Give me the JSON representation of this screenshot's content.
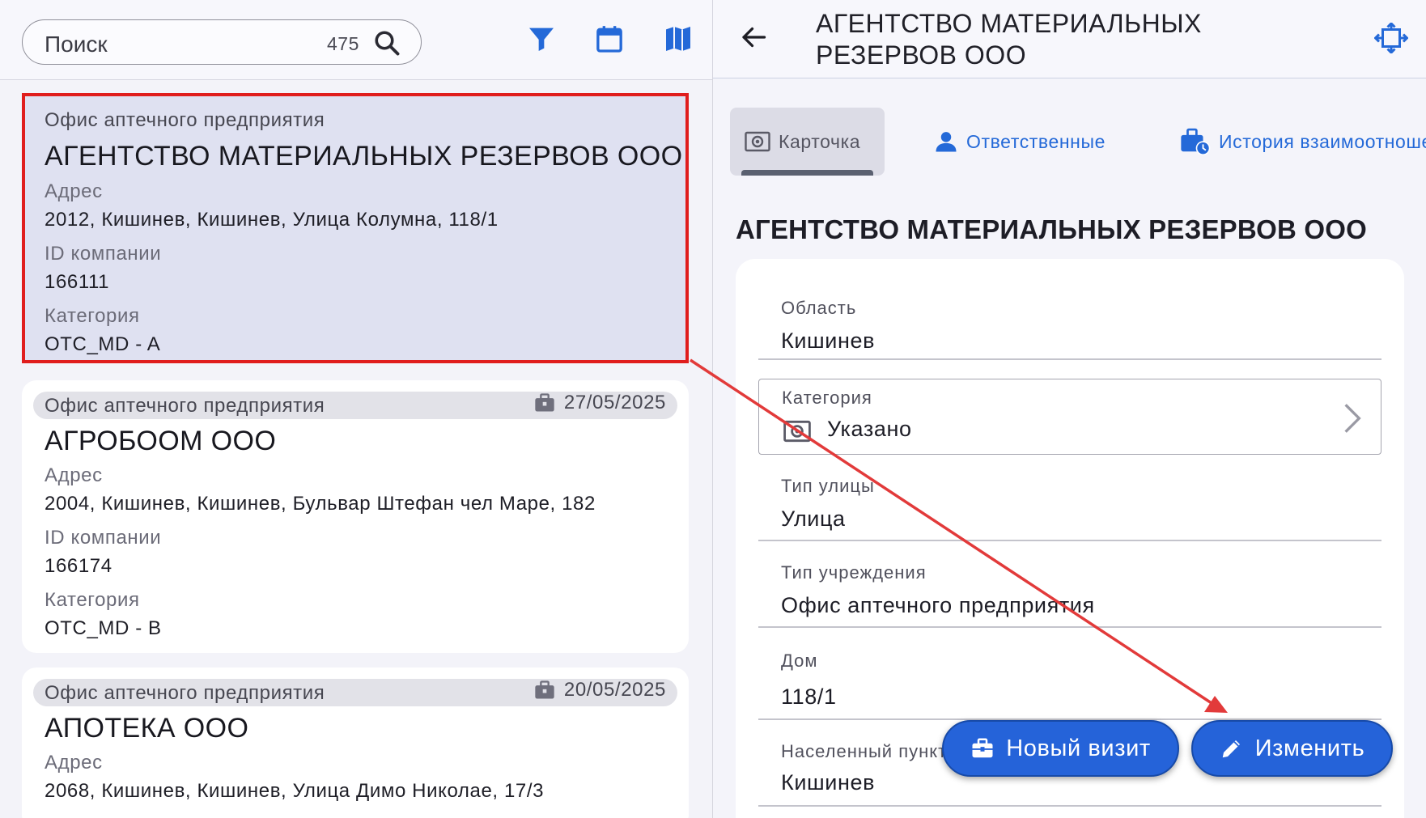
{
  "search": {
    "placeholder": "Поиск",
    "count": "475"
  },
  "header_icons": [
    "filter-icon",
    "calendar-icon",
    "map-icon"
  ],
  "list": [
    {
      "type": "Офис аптечного предприятия",
      "date": "",
      "name": "АГЕНТСТВО МАТЕРИАЛЬНЫХ РЕЗЕРВОВ ООО",
      "address_label": "Адрес",
      "address": "2012, Кишинев, Кишинев, Улица Колумна, 118/1",
      "id_label": "ID компании",
      "id": "166111",
      "category_label": "Категория",
      "category": "OTC_MD - A"
    },
    {
      "type": "Офис аптечного предприятия",
      "date": "27/05/2025",
      "name": "АГРОБООМ ООО",
      "address_label": "Адрес",
      "address": "2004, Кишинев, Кишинев, Бульвар Штефан чел Маре, 182",
      "id_label": "ID компании",
      "id": "166174",
      "category_label": "Категория",
      "category": "OTC_MD - B"
    },
    {
      "type": "Офис аптечного предприятия",
      "date": "20/05/2025",
      "name": "АПОТЕКА ООО",
      "address_label": "Адрес",
      "address": "2068, Кишинев, Кишинев, Улица Димо Николае, 17/3"
    }
  ],
  "detail": {
    "header_title": "АГЕНТСТВО МАТЕРИАЛЬНЫХ РЕЗЕРВОВ ООО",
    "tabs": [
      {
        "label": "Карточка",
        "icon": "card-icon",
        "active": true
      },
      {
        "label": "Ответственные",
        "icon": "person-icon",
        "active": false
      },
      {
        "label": "История взаимоотношений",
        "icon": "history-icon",
        "active": false
      }
    ],
    "section_title": "АГЕНТСТВО МАТЕРИАЛЬНЫХ РЕЗЕРВОВ ООО",
    "fields": {
      "region": {
        "label": "Область",
        "value": "Кишинев"
      },
      "category": {
        "label": "Категория",
        "value": "Указано"
      },
      "street_type": {
        "label": "Тип улицы",
        "value": "Улица"
      },
      "institution_type": {
        "label": "Тип учреждения",
        "value": "Офис аптечного предприятия"
      },
      "house": {
        "label": "Дом",
        "value": "118/1"
      },
      "locality": {
        "label": "Населенный пункт",
        "value": "Кишинев"
      }
    },
    "buttons": {
      "new_visit": "Новый визит",
      "edit": "Изменить"
    }
  },
  "colors": {
    "accent": "#2563d9",
    "highlight": "#e01d1d",
    "selected_bg": "#dfe1f1"
  }
}
